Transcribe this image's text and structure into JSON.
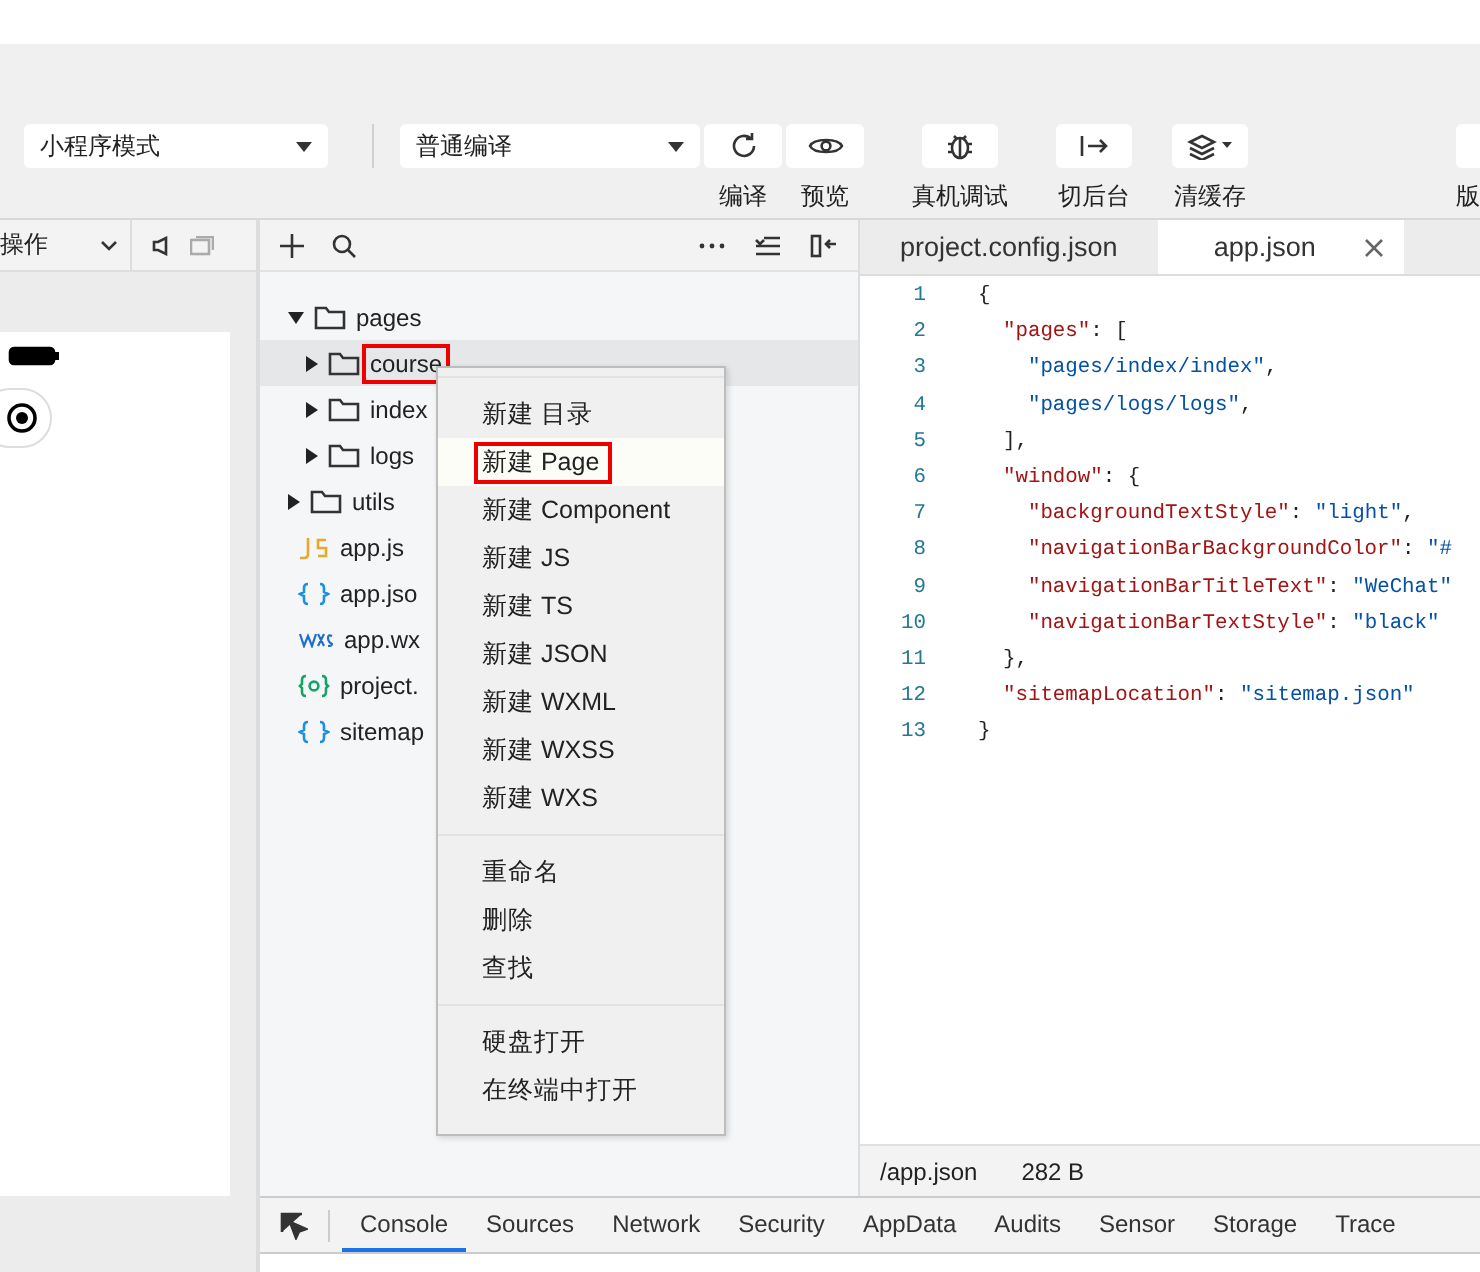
{
  "toolbar": {
    "mode_select": "小程序模式",
    "compile_select": "普通编译",
    "buttons": [
      {
        "label": "编译"
      },
      {
        "label": "预览"
      },
      {
        "label": "真机调试"
      },
      {
        "label": "切后台"
      },
      {
        "label": "清缓存"
      },
      {
        "label": "版"
      }
    ]
  },
  "simulator": {
    "operation_select": "操作"
  },
  "file_tree": [
    {
      "name": "pages",
      "kind": "folder",
      "expanded": true,
      "selected": false,
      "marked": false,
      "children": [
        {
          "name": "course",
          "kind": "folder",
          "expanded": false,
          "selected": true,
          "marked": true
        },
        {
          "name": "index",
          "kind": "folder",
          "expanded": false,
          "selected": false,
          "marked": false
        },
        {
          "name": "logs",
          "kind": "folder",
          "expanded": false,
          "selected": false,
          "marked": false
        }
      ]
    },
    {
      "name": "utils",
      "kind": "folder",
      "expanded": false,
      "selected": false,
      "marked": false
    },
    {
      "name": "app.js",
      "kind": "js",
      "selected": false,
      "marked": false
    },
    {
      "name": "app.jso",
      "kind": "json",
      "selected": false,
      "marked": false
    },
    {
      "name": "app.wx",
      "kind": "wxss",
      "selected": false,
      "marked": false
    },
    {
      "name": "project.",
      "kind": "config",
      "selected": false,
      "marked": false
    },
    {
      "name": "sitemap",
      "kind": "json",
      "selected": false,
      "marked": false
    }
  ],
  "context_menu": [
    [
      {
        "label": "新建 目录",
        "selected": false,
        "marked": false
      },
      {
        "label": "新建 Page",
        "selected": true,
        "marked": true
      },
      {
        "label": "新建 Component",
        "selected": false,
        "marked": false
      },
      {
        "label": "新建 JS",
        "selected": false,
        "marked": false
      },
      {
        "label": "新建 TS",
        "selected": false,
        "marked": false
      },
      {
        "label": "新建 JSON",
        "selected": false,
        "marked": false
      },
      {
        "label": "新建 WXML",
        "selected": false,
        "marked": false
      },
      {
        "label": "新建 WXSS",
        "selected": false,
        "marked": false
      },
      {
        "label": "新建 WXS",
        "selected": false,
        "marked": false
      }
    ],
    [
      {
        "label": "重命名",
        "selected": false,
        "marked": false
      },
      {
        "label": "删除",
        "selected": false,
        "marked": false
      },
      {
        "label": "查找",
        "selected": false,
        "marked": false
      }
    ],
    [
      {
        "label": "硬盘打开",
        "selected": false,
        "marked": false
      },
      {
        "label": "在终端中打开",
        "selected": false,
        "marked": false
      }
    ]
  ],
  "editor": {
    "tabs": [
      {
        "label": "project.config.json",
        "selected": false
      },
      {
        "label": "app.json",
        "selected": true
      }
    ],
    "lines": [
      {
        "number": "1",
        "code": "{"
      },
      {
        "number": "2",
        "code": "  \"pages\": ["
      },
      {
        "number": "3",
        "code": "    \"pages/index/index\","
      },
      {
        "number": "4",
        "code": "    \"pages/logs/logs\","
      },
      {
        "number": "5",
        "code": "  ],"
      },
      {
        "number": "6",
        "code": "  \"window\": {"
      },
      {
        "number": "7",
        "code": "    \"backgroundTextStyle\": \"light\","
      },
      {
        "number": "8",
        "code": "    \"navigationBarBackgroundColor\": \"#"
      },
      {
        "number": "9",
        "code": "    \"navigationBarTitleText\": \"WeChat\""
      },
      {
        "number": "10",
        "code": "    \"navigationBarTextStyle\": \"black\""
      },
      {
        "number": "11",
        "code": "  },"
      },
      {
        "number": "12",
        "code": "  \"sitemapLocation\": \"sitemap.json\""
      },
      {
        "number": "13",
        "code": "}"
      }
    ],
    "status": {
      "path": "/app.json",
      "size": "282 B"
    }
  },
  "devtools_tabs": [
    {
      "label": "Console",
      "selected": true
    },
    {
      "label": "Sources",
      "selected": false
    },
    {
      "label": "Network",
      "selected": false
    },
    {
      "label": "Security",
      "selected": false
    },
    {
      "label": "AppData",
      "selected": false
    },
    {
      "label": "Audits",
      "selected": false
    },
    {
      "label": "Sensor",
      "selected": false
    },
    {
      "label": "Storage",
      "selected": false
    },
    {
      "label": "Trace",
      "selected": false
    }
  ]
}
